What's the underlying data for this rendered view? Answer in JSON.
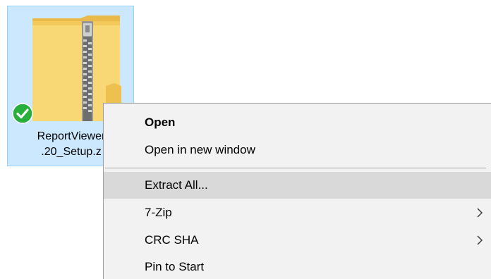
{
  "file": {
    "name_line1": "ReportViewer",
    "name_line2": ".20_Setup.z",
    "icon": "zip-folder-icon",
    "status_icon": "sync-ok-check-icon",
    "colors": {
      "selection_bg": "#cce8ff",
      "selection_border": "#99d1ff",
      "folder": "#f8d775",
      "check": "#27ae3b"
    }
  },
  "context_menu": {
    "items": [
      {
        "label": "Open",
        "bold": true,
        "submenu": false
      },
      {
        "label": "Open in new window",
        "bold": false,
        "submenu": false
      },
      {
        "label": "Extract All...",
        "bold": false,
        "submenu": false,
        "highlighted": true
      },
      {
        "label": "7-Zip",
        "bold": false,
        "submenu": true,
        "icon": "chevron-right-icon"
      },
      {
        "label": "CRC SHA",
        "bold": false,
        "submenu": true,
        "icon": "chevron-right-icon"
      },
      {
        "label": "Pin to Start",
        "bold": false,
        "submenu": false
      }
    ],
    "colors": {
      "background": "#f2f2f2",
      "highlight": "#d9d9d9",
      "separator": "#a6a6a6"
    }
  }
}
